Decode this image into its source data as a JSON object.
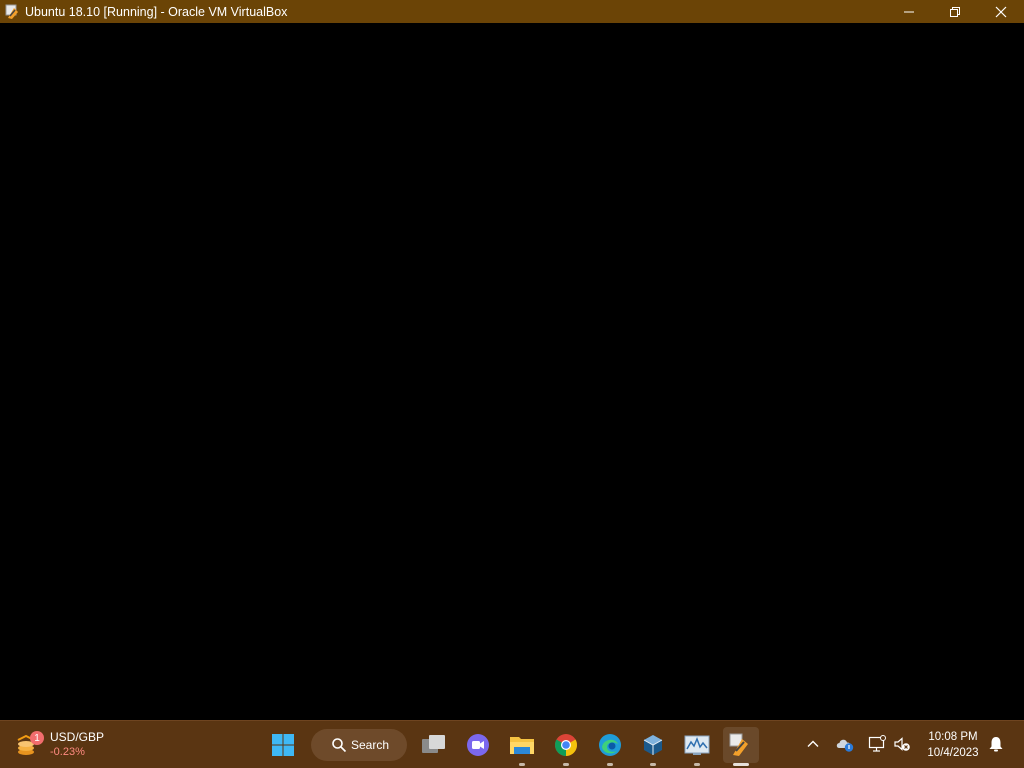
{
  "window": {
    "title": "Ubuntu 18.10 [Running] - Oracle VM VirtualBox",
    "app_icon": "virtualbox-vm-icon",
    "controls": [
      "minimize-icon",
      "restore-icon",
      "close-icon"
    ],
    "title_bar_color": "#6b4406"
  },
  "vm_screen": {
    "background": "#000000"
  },
  "taskbar": {
    "background": "#5a3512",
    "widget": {
      "title": "USD/GBP",
      "change": "-0.23%",
      "badge": "1",
      "icon": "currency-coins-icon"
    },
    "search": {
      "label": "Search"
    },
    "pinned": [
      {
        "name": "start",
        "icon": "windows-start-icon"
      },
      {
        "name": "task-view",
        "icon": "task-view-icon"
      },
      {
        "name": "meet",
        "icon": "video-meeting-icon"
      },
      {
        "name": "file-explorer",
        "icon": "folder-icon"
      },
      {
        "name": "chrome",
        "icon": "chrome-icon"
      },
      {
        "name": "edge",
        "icon": "edge-icon"
      },
      {
        "name": "virtualbox",
        "icon": "virtualbox-icon"
      },
      {
        "name": "resource-monitor",
        "icon": "monitor-chart-icon"
      },
      {
        "name": "vm-window",
        "icon": "virtualbox-vm-icon",
        "active": true
      }
    ],
    "tray": {
      "icons": [
        "chevron-up-icon",
        "onedrive-cloud-icon",
        "network-icon",
        "speaker-muted-icon",
        "notification-bell-icon"
      ],
      "time": "10:08 PM",
      "date": "10/4/2023"
    }
  }
}
